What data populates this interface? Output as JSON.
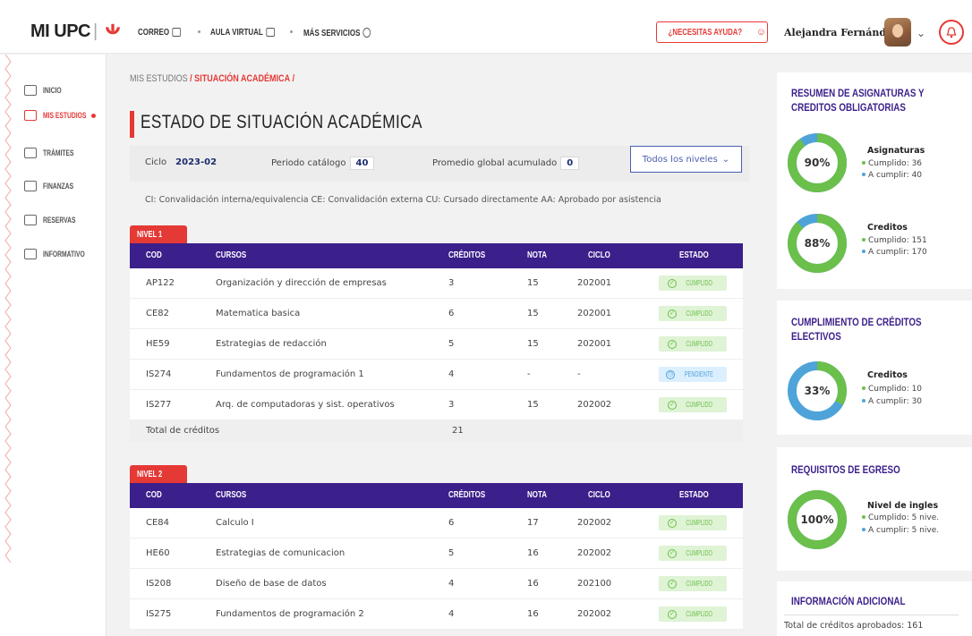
{
  "header": {
    "logo": "MI UPC",
    "nav": [
      {
        "label": "CORREO"
      },
      {
        "label": "AULA VIRTUAL"
      },
      {
        "label": "MÁS SERVICIOS"
      }
    ],
    "help_label": "¿NECESITAS AYUDA?",
    "user_name": "Alejandra Fernández"
  },
  "sidebar": {
    "items": [
      {
        "label": "INICIO",
        "active": false
      },
      {
        "label": "MIS ESTUDIOS",
        "active": true
      },
      {
        "label": "TRÁMITES",
        "active": false
      },
      {
        "label": "FINANZAS",
        "active": false
      },
      {
        "label": "RESERVAS",
        "active": false
      },
      {
        "label": "INFORMATIVO",
        "active": false
      }
    ]
  },
  "breadcrumb": {
    "parent": "MIS ESTUDIOS",
    "sep": "/",
    "current": "SITUACIÓN ACADÉMICA",
    "trail": "/"
  },
  "page_title": "ESTADO DE SITUACIÓN ACADÉMICA",
  "filters": {
    "ciclo_label": "Ciclo",
    "ciclo_value": "2023-02",
    "periodo_label": "Periodo catálogo",
    "periodo_value": "40",
    "promedio_label": "Promedio global acumulado",
    "promedio_value": "0",
    "levels_select": "Todos los niveles"
  },
  "legend": "CI: Convalidación interna/equivalencia   CE: Convalidación externa   CU: Cursado directamente   AA: Aprobado por asistencia",
  "table_headers": {
    "cod": "COD",
    "cursos": "CURSOS",
    "creditos": "CRÉDITOS",
    "nota": "NOTA",
    "ciclo": "CICLO",
    "estado": "ESTADO"
  },
  "levels": [
    {
      "label": "NIVEL 1",
      "rows": [
        {
          "cod": "AP122",
          "curso": "Organización y dirección de empresas",
          "creditos": "3",
          "nota": "15",
          "ciclo": "202001",
          "estado": "CUMPLIDO"
        },
        {
          "cod": "CE82",
          "curso": "Matematica basica",
          "creditos": "6",
          "nota": "15",
          "ciclo": "202001",
          "estado": "CUMPLIDO"
        },
        {
          "cod": "HE59",
          "curso": "Estrategias de redacción",
          "creditos": "5",
          "nota": "15",
          "ciclo": "202001",
          "estado": "CUMPLIDO"
        },
        {
          "cod": "IS274",
          "curso": "Fundamentos de programación 1",
          "creditos": "4",
          "nota": "-",
          "ciclo": "-",
          "estado": "PENDIENTE"
        },
        {
          "cod": "IS277",
          "curso": "Arq. de computadoras y sist. operativos",
          "creditos": "3",
          "nota": "15",
          "ciclo": "202002",
          "estado": "CUMPLIDO"
        }
      ],
      "total_label": "Total de créditos",
      "total_value": "21"
    },
    {
      "label": "NIVEL 2",
      "rows": [
        {
          "cod": "CE84",
          "curso": "Calculo I",
          "creditos": "6",
          "nota": "17",
          "ciclo": "202002",
          "estado": "CUMPLIDO"
        },
        {
          "cod": "HE60",
          "curso": "Estrategias de comunicacion",
          "creditos": "5",
          "nota": "16",
          "ciclo": "202002",
          "estado": "CUMPLIDO"
        },
        {
          "cod": "IS208",
          "curso": "Diseño de base de datos",
          "creditos": "4",
          "nota": "16",
          "ciclo": "202100",
          "estado": "CUMPLIDO"
        },
        {
          "cod": "IS275",
          "curso": "Fundamentos de programación 2",
          "creditos": "4",
          "nota": "16",
          "ciclo": "202002",
          "estado": "CUMPLIDO"
        }
      ]
    }
  ],
  "right_panel": {
    "resumen": {
      "title": "RESUMEN DE ASIGNATURAS Y CREDITOS OBLIGATORIAS",
      "asignaturas": {
        "label": "Asignaturas",
        "percent": "90%",
        "cumplido": "Cumplido: 36",
        "a_cumplir": "A cumplir: 40",
        "fraction": 0.9
      },
      "creditos": {
        "label": "Creditos",
        "percent": "88%",
        "cumplido": "Cumplido: 151",
        "a_cumplir": "A cumplir: 170",
        "fraction": 0.88
      }
    },
    "electivos": {
      "title": "CUMPLIMIENTO DE CRÉDITOS ELECTIVOS",
      "creditos": {
        "label": "Creditos",
        "percent": "33%",
        "cumplido": "Cumplido: 10",
        "a_cumplir": "A cumplir: 30",
        "fraction": 0.33
      }
    },
    "egreso": {
      "title": "REQUISITOS DE EGRESO",
      "ingles": {
        "label": "Nivel de ingles",
        "percent": "100%",
        "cumplido": "Cumplido: 5 nive.",
        "a_cumplir": "A cumplir: 5 nive.",
        "fraction": 1.0
      }
    },
    "info": {
      "title": "INFORMACIÓN ADICIONAL",
      "total_aprobados": "Total de créditos aprobados: 161"
    }
  },
  "colors": {
    "accent": "#e53935",
    "header_purple": "#3b1f8b",
    "done_green": "#6bbf4b",
    "pending_blue": "#4ea3d8"
  }
}
